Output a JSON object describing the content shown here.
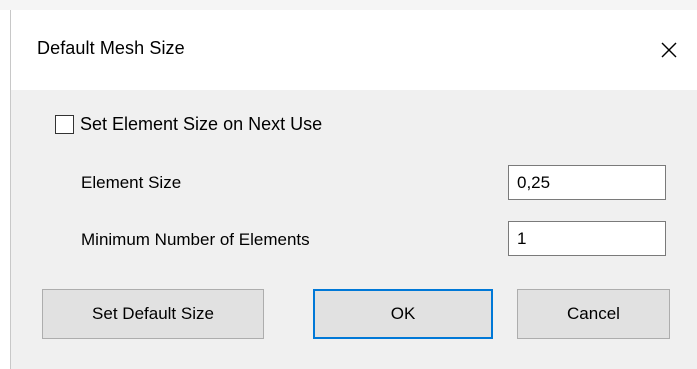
{
  "dialog": {
    "title": "Default Mesh Size",
    "close_glyph": "✕"
  },
  "checkbox": {
    "label": "Set Element Size on Next Use",
    "checked": false
  },
  "fields": [
    {
      "label": "Element Size",
      "value": "0,25"
    },
    {
      "label": "Minimum Number of Elements",
      "value": "1"
    }
  ],
  "buttons": {
    "set_default": "Set Default Size",
    "ok": "OK",
    "cancel": "Cancel"
  },
  "colors": {
    "focus_border": "#0078d7",
    "button_face": "#e1e1e1",
    "dialog_body": "#f0f0f0"
  },
  "icons": {
    "close": "close-icon"
  }
}
